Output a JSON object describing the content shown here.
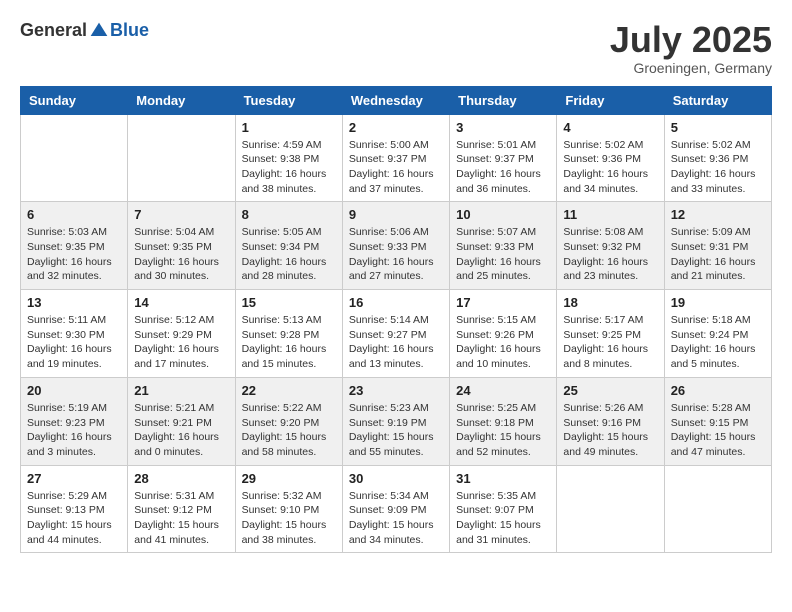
{
  "logo": {
    "general": "General",
    "blue": "Blue"
  },
  "title": "July 2025",
  "subtitle": "Groeningen, Germany",
  "headers": [
    "Sunday",
    "Monday",
    "Tuesday",
    "Wednesday",
    "Thursday",
    "Friday",
    "Saturday"
  ],
  "weeks": [
    [
      {
        "day": "",
        "detail": ""
      },
      {
        "day": "",
        "detail": ""
      },
      {
        "day": "1",
        "detail": "Sunrise: 4:59 AM\nSunset: 9:38 PM\nDaylight: 16 hours\nand 38 minutes."
      },
      {
        "day": "2",
        "detail": "Sunrise: 5:00 AM\nSunset: 9:37 PM\nDaylight: 16 hours\nand 37 minutes."
      },
      {
        "day": "3",
        "detail": "Sunrise: 5:01 AM\nSunset: 9:37 PM\nDaylight: 16 hours\nand 36 minutes."
      },
      {
        "day": "4",
        "detail": "Sunrise: 5:02 AM\nSunset: 9:36 PM\nDaylight: 16 hours\nand 34 minutes."
      },
      {
        "day": "5",
        "detail": "Sunrise: 5:02 AM\nSunset: 9:36 PM\nDaylight: 16 hours\nand 33 minutes."
      }
    ],
    [
      {
        "day": "6",
        "detail": "Sunrise: 5:03 AM\nSunset: 9:35 PM\nDaylight: 16 hours\nand 32 minutes."
      },
      {
        "day": "7",
        "detail": "Sunrise: 5:04 AM\nSunset: 9:35 PM\nDaylight: 16 hours\nand 30 minutes."
      },
      {
        "day": "8",
        "detail": "Sunrise: 5:05 AM\nSunset: 9:34 PM\nDaylight: 16 hours\nand 28 minutes."
      },
      {
        "day": "9",
        "detail": "Sunrise: 5:06 AM\nSunset: 9:33 PM\nDaylight: 16 hours\nand 27 minutes."
      },
      {
        "day": "10",
        "detail": "Sunrise: 5:07 AM\nSunset: 9:33 PM\nDaylight: 16 hours\nand 25 minutes."
      },
      {
        "day": "11",
        "detail": "Sunrise: 5:08 AM\nSunset: 9:32 PM\nDaylight: 16 hours\nand 23 minutes."
      },
      {
        "day": "12",
        "detail": "Sunrise: 5:09 AM\nSunset: 9:31 PM\nDaylight: 16 hours\nand 21 minutes."
      }
    ],
    [
      {
        "day": "13",
        "detail": "Sunrise: 5:11 AM\nSunset: 9:30 PM\nDaylight: 16 hours\nand 19 minutes."
      },
      {
        "day": "14",
        "detail": "Sunrise: 5:12 AM\nSunset: 9:29 PM\nDaylight: 16 hours\nand 17 minutes."
      },
      {
        "day": "15",
        "detail": "Sunrise: 5:13 AM\nSunset: 9:28 PM\nDaylight: 16 hours\nand 15 minutes."
      },
      {
        "day": "16",
        "detail": "Sunrise: 5:14 AM\nSunset: 9:27 PM\nDaylight: 16 hours\nand 13 minutes."
      },
      {
        "day": "17",
        "detail": "Sunrise: 5:15 AM\nSunset: 9:26 PM\nDaylight: 16 hours\nand 10 minutes."
      },
      {
        "day": "18",
        "detail": "Sunrise: 5:17 AM\nSunset: 9:25 PM\nDaylight: 16 hours\nand 8 minutes."
      },
      {
        "day": "19",
        "detail": "Sunrise: 5:18 AM\nSunset: 9:24 PM\nDaylight: 16 hours\nand 5 minutes."
      }
    ],
    [
      {
        "day": "20",
        "detail": "Sunrise: 5:19 AM\nSunset: 9:23 PM\nDaylight: 16 hours\nand 3 minutes."
      },
      {
        "day": "21",
        "detail": "Sunrise: 5:21 AM\nSunset: 9:21 PM\nDaylight: 16 hours\nand 0 minutes."
      },
      {
        "day": "22",
        "detail": "Sunrise: 5:22 AM\nSunset: 9:20 PM\nDaylight: 15 hours\nand 58 minutes."
      },
      {
        "day": "23",
        "detail": "Sunrise: 5:23 AM\nSunset: 9:19 PM\nDaylight: 15 hours\nand 55 minutes."
      },
      {
        "day": "24",
        "detail": "Sunrise: 5:25 AM\nSunset: 9:18 PM\nDaylight: 15 hours\nand 52 minutes."
      },
      {
        "day": "25",
        "detail": "Sunrise: 5:26 AM\nSunset: 9:16 PM\nDaylight: 15 hours\nand 49 minutes."
      },
      {
        "day": "26",
        "detail": "Sunrise: 5:28 AM\nSunset: 9:15 PM\nDaylight: 15 hours\nand 47 minutes."
      }
    ],
    [
      {
        "day": "27",
        "detail": "Sunrise: 5:29 AM\nSunset: 9:13 PM\nDaylight: 15 hours\nand 44 minutes."
      },
      {
        "day": "28",
        "detail": "Sunrise: 5:31 AM\nSunset: 9:12 PM\nDaylight: 15 hours\nand 41 minutes."
      },
      {
        "day": "29",
        "detail": "Sunrise: 5:32 AM\nSunset: 9:10 PM\nDaylight: 15 hours\nand 38 minutes."
      },
      {
        "day": "30",
        "detail": "Sunrise: 5:34 AM\nSunset: 9:09 PM\nDaylight: 15 hours\nand 34 minutes."
      },
      {
        "day": "31",
        "detail": "Sunrise: 5:35 AM\nSunset: 9:07 PM\nDaylight: 15 hours\nand 31 minutes."
      },
      {
        "day": "",
        "detail": ""
      },
      {
        "day": "",
        "detail": ""
      }
    ]
  ]
}
